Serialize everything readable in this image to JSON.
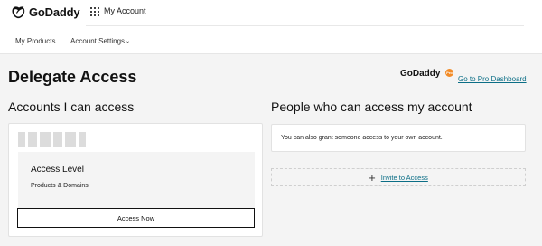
{
  "header": {
    "logo_text": "GoDaddy",
    "app_label": "My Account",
    "icons": {
      "logo": "godaddy-logo-icon",
      "apps": "apps-grid-icon"
    }
  },
  "subnav": {
    "products_label": "My Products",
    "settings_label": "Account Settings",
    "settings_caret": "⌄"
  },
  "page": {
    "title": "Delegate Access",
    "brand_logo": "GoDaddy",
    "brand_badge": "Pro",
    "pro_link": "Go to Pro Dashboard"
  },
  "accounts_section": {
    "title": "Accounts I can access",
    "access_level_title": "Access Level",
    "access_level_value": "Products & Domains",
    "access_button": "Access Now"
  },
  "people_section": {
    "title": "People who can access my account",
    "grant_text": "You can also grant someone access to your own account.",
    "invite_label": "Invite to Access",
    "invite_icon": "+"
  },
  "colors": {
    "link": "#0b6e86",
    "page_bg": "#f4f4f4",
    "pro_badge": "#f28c28"
  }
}
